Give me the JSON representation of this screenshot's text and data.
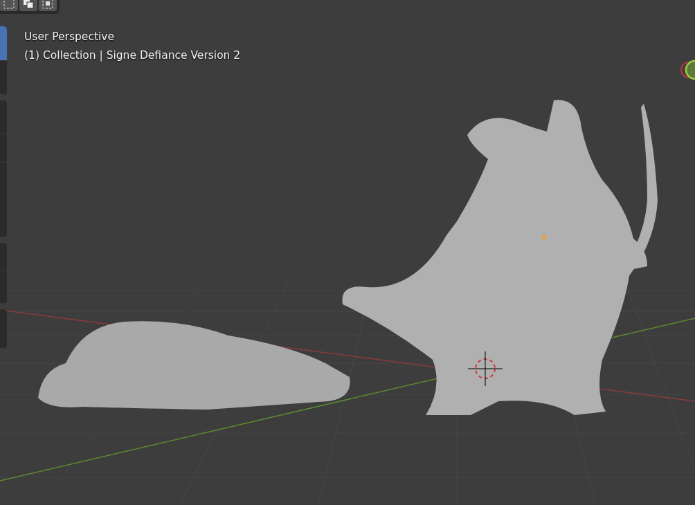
{
  "overlay": {
    "view_name": "User Perspective",
    "collection_line": "(1) Collection | Signe Defiance Version 2"
  },
  "toolbar": {
    "groups": [
      {
        "tools": [
          {
            "selected": true
          },
          {
            "selected": false
          }
        ]
      },
      {
        "tools": [
          {
            "selected": false
          },
          {
            "selected": false
          },
          {
            "selected": false
          }
        ]
      },
      {
        "tools": [
          {
            "selected": false
          },
          {
            "selected": false
          }
        ]
      },
      {
        "tools": [
          {
            "selected": false
          }
        ]
      }
    ]
  }
}
